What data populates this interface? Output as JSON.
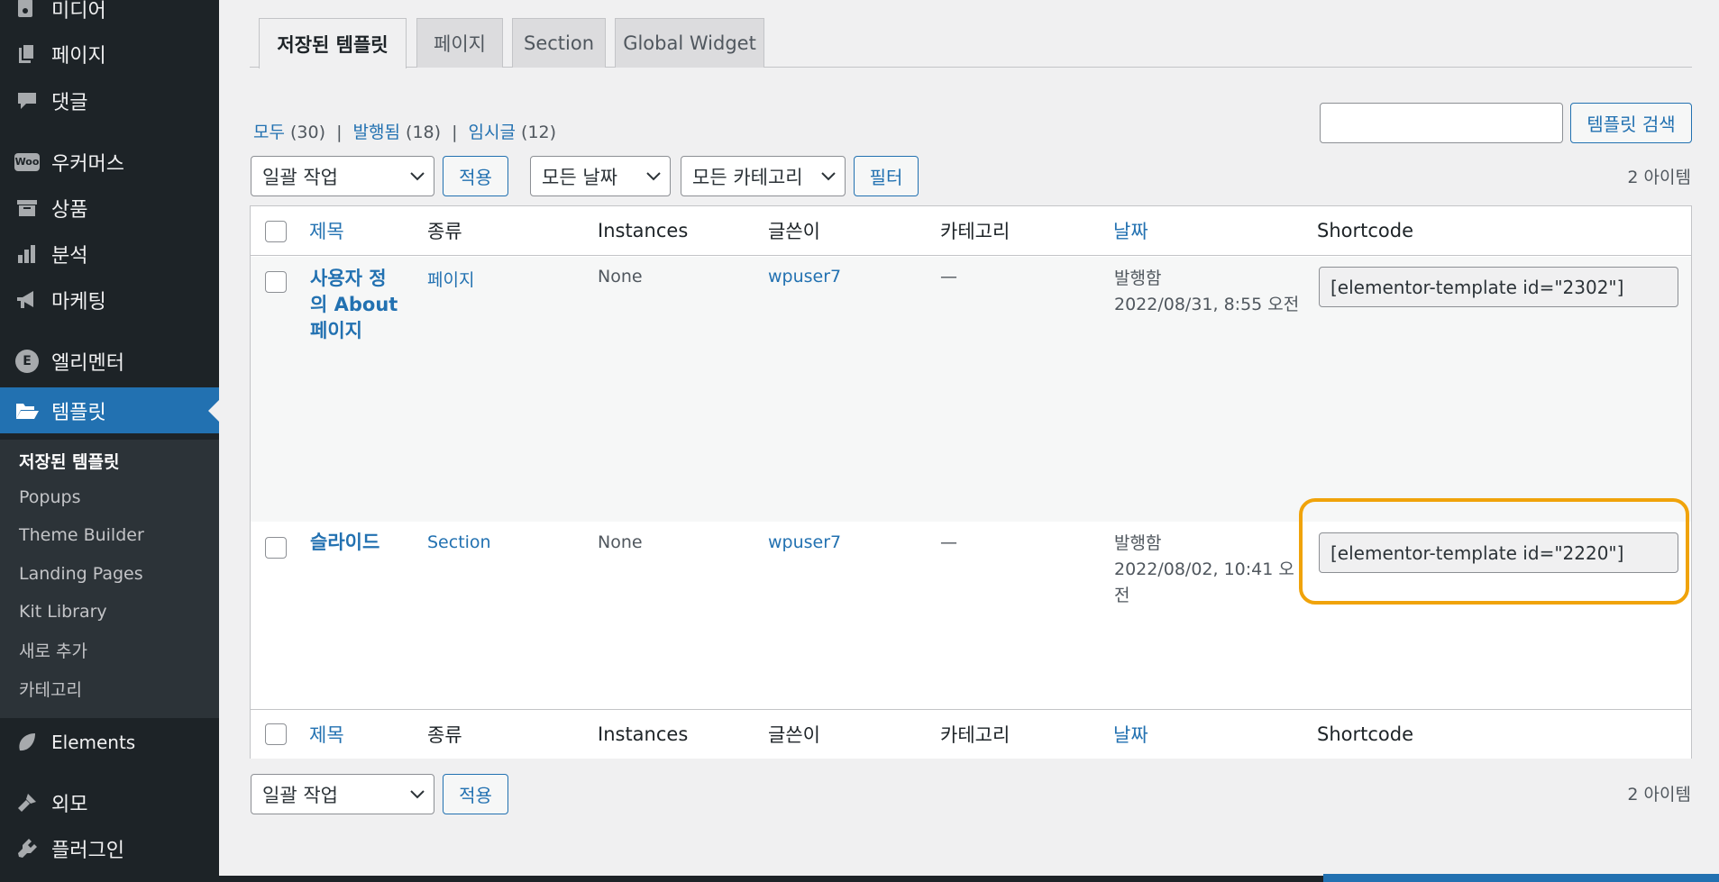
{
  "sidebar": {
    "items": [
      {
        "label": "미디어",
        "icon": "media-icon"
      },
      {
        "label": "페이지",
        "icon": "page-icon"
      },
      {
        "label": "댓글",
        "icon": "comment-icon"
      },
      {
        "label": "우커머스",
        "icon": "woo-icon",
        "icon_text": "Woo"
      },
      {
        "label": "상품",
        "icon": "archive-icon"
      },
      {
        "label": "분석",
        "icon": "chart-bar-icon"
      },
      {
        "label": "마케팅",
        "icon": "megaphone-icon"
      },
      {
        "label": "엘리멘터",
        "icon": "elementor-icon",
        "icon_text": "E"
      },
      {
        "label": "템플릿",
        "icon": "folder-open-icon"
      }
    ],
    "submenu": [
      "저장된 템플릿",
      "Popups",
      "Theme Builder",
      "Landing Pages",
      "Kit Library",
      "새로 추가",
      "카테고리"
    ],
    "bottom_items": [
      {
        "label": "Elements",
        "icon": "leaf-icon"
      },
      {
        "label": "외모",
        "icon": "brush-icon"
      },
      {
        "label": "플러그인",
        "icon": "plugin-icon"
      }
    ]
  },
  "tabs": [
    "저장된 템플릿",
    "페이지",
    "Section",
    "Global Widget"
  ],
  "status_links": {
    "all": "모두",
    "all_count": "(30)",
    "published": "발행됨",
    "published_count": "(18)",
    "draft": "임시글",
    "draft_count": "(12)",
    "separator": "|"
  },
  "search": {
    "button": "템플릿 검색",
    "value": ""
  },
  "bulk": {
    "select": "일괄 작업",
    "apply": "적용"
  },
  "filters": {
    "date": "모든 날짜",
    "category": "모든 카테고리",
    "button": "필터"
  },
  "items_count": "2 아이템",
  "columns": {
    "title": "제목",
    "type": "종류",
    "instances": "Instances",
    "author": "글쓴이",
    "category": "카테고리",
    "date": "날짜",
    "shortcode": "Shortcode"
  },
  "rows": [
    {
      "title_lines": [
        "사용자 정",
        "의 About",
        "페이지"
      ],
      "type": "페이지",
      "instances": "None",
      "author": "wpuser7",
      "category": "—",
      "date_status": "발행함",
      "date_lines": [
        "2022/08/31, 8:55 오전"
      ],
      "shortcode": "[elementor-template id=\"2302\"]"
    },
    {
      "title_lines": [
        "슬라이드"
      ],
      "type": "Section",
      "instances": "None",
      "author": "wpuser7",
      "category": "—",
      "date_status": "발행함",
      "date_lines": [
        "2022/08/02, 10:41 오",
        "전"
      ],
      "shortcode": "[elementor-template id=\"2220\"]"
    }
  ],
  "colors": {
    "accent": "#2271b1",
    "sidebar": "#1d2327",
    "highlight": "#f0a30a"
  }
}
